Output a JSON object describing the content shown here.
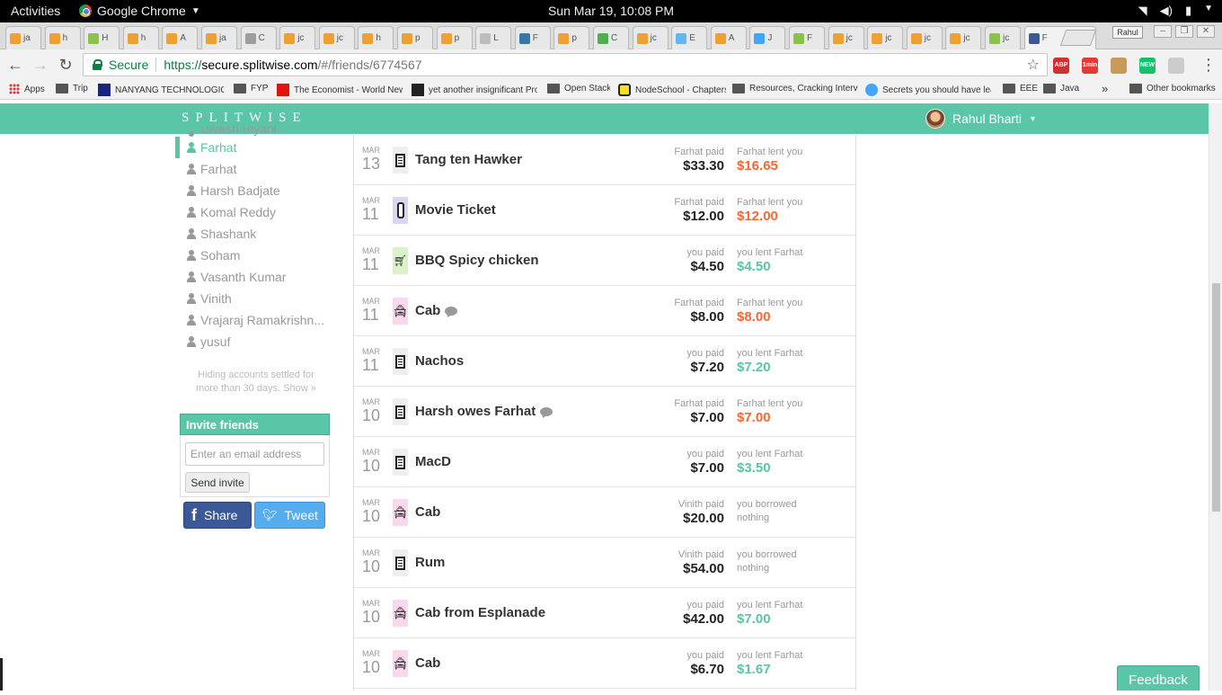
{
  "gnome": {
    "activities": "Activities",
    "app_name": "Google Chrome",
    "clock": "Sun Mar 19, 10:08 PM"
  },
  "browser": {
    "tabs": [
      {
        "label": "ja",
        "color": "#f0a030"
      },
      {
        "label": "h",
        "color": "#f0a030"
      },
      {
        "label": "H",
        "color": "#8bc34a"
      },
      {
        "label": "h",
        "color": "#f0a030"
      },
      {
        "label": "A",
        "color": "#f0a030"
      },
      {
        "label": "ja",
        "color": "#f0a030"
      },
      {
        "label": "C",
        "color": "#9e9e9e"
      },
      {
        "label": "jc",
        "color": "#f0a030"
      },
      {
        "label": "jc",
        "color": "#f0a030"
      },
      {
        "label": "h",
        "color": "#f0a030"
      },
      {
        "label": "p",
        "color": "#f0a030"
      },
      {
        "label": "p",
        "color": "#f0a030"
      },
      {
        "label": "L",
        "color": "#bdbdbd"
      },
      {
        "label": "F",
        "color": "#3776ab"
      },
      {
        "label": "p",
        "color": "#f0a030"
      },
      {
        "label": "C",
        "color": "#4caf50"
      },
      {
        "label": "jc",
        "color": "#f0a030"
      },
      {
        "label": "E",
        "color": "#64b5f6"
      },
      {
        "label": "A",
        "color": "#f0a030"
      },
      {
        "label": "J",
        "color": "#42a5f5"
      },
      {
        "label": "F",
        "color": "#8bc34a"
      },
      {
        "label": "jc",
        "color": "#f0a030"
      },
      {
        "label": "jc",
        "color": "#f0a030"
      },
      {
        "label": "jc",
        "color": "#f0a030"
      },
      {
        "label": "jc",
        "color": "#f0a030"
      },
      {
        "label": "jc",
        "color": "#8bc34a"
      },
      {
        "label": "F",
        "color": "#3b5998"
      }
    ],
    "active_tab_label": "F",
    "profile": "Rahul",
    "omnibox": {
      "secure_label": "Secure",
      "url_scheme": "https://",
      "url_host": "secure.splitwise.com",
      "url_path": "/#/friends/6774567"
    },
    "extensions": [
      {
        "label": "ABP",
        "color": "#d32f2f"
      },
      {
        "label": "1min",
        "color": "#e53935"
      },
      {
        "label": "",
        "color": "#c89a5a"
      },
      {
        "label": "NEW",
        "color": "#15c26b"
      },
      {
        "label": "",
        "color": "#cccccc"
      }
    ],
    "bookmarks": [
      {
        "label": "Apps",
        "icon": "apps-icon"
      },
      {
        "label": "Trip",
        "icon": "folder-icon"
      },
      {
        "label": "NANYANG TECHNOLOGICAL",
        "icon": "ntu-icon"
      },
      {
        "label": "FYP",
        "icon": "folder-icon"
      },
      {
        "label": "The Economist - World News",
        "icon": "economist-icon"
      },
      {
        "label": "yet another insignificant Prog",
        "icon": "blog-icon"
      },
      {
        "label": "Open Stack",
        "icon": "folder-icon"
      },
      {
        "label": "NodeSchool - Chapters",
        "icon": "nodeschool-icon"
      },
      {
        "label": "Resources, Cracking Intervie",
        "icon": "folder-icon"
      },
      {
        "label": "Secrets you should have lear",
        "icon": "secrets-icon"
      },
      {
        "label": "EEE",
        "icon": "folder-icon"
      },
      {
        "label": "Java",
        "icon": "folder-icon"
      }
    ],
    "bookmarks_overflow": "»",
    "other_bookmarks": "Other bookmarks"
  },
  "header": {
    "logo": "SPLITWISE",
    "user_name": "Rahul Bharti"
  },
  "sidebar": {
    "friends": [
      {
        "name": "Divesh Biyani",
        "active": false,
        "clipped": true
      },
      {
        "name": "Farhat",
        "active": true,
        "clipped": false
      },
      {
        "name": "Farhat",
        "active": false,
        "clipped": false
      },
      {
        "name": "Harsh Badjate",
        "active": false,
        "clipped": false
      },
      {
        "name": "Komal Reddy",
        "active": false,
        "clipped": false
      },
      {
        "name": "Shashank",
        "active": false,
        "clipped": false
      },
      {
        "name": "Soham",
        "active": false,
        "clipped": false
      },
      {
        "name": "Vasanth Kumar",
        "active": false,
        "clipped": false
      },
      {
        "name": "Vinith",
        "active": false,
        "clipped": false
      },
      {
        "name": "Vrajaraj Ramakrishn...",
        "active": false,
        "clipped": false
      },
      {
        "name": "yusuf",
        "active": false,
        "clipped": false
      }
    ],
    "hidden_note": "Hiding accounts settled for more than 30 days. Show »",
    "invite": {
      "title": "Invite friends",
      "placeholder": "Enter an email address",
      "button": "Send invite"
    },
    "share_label": "Share",
    "tweet_label": "Tweet"
  },
  "expenses": [
    {
      "month": "MAR",
      "day": "13",
      "category": "receipt",
      "description": "Tang ten Hawker",
      "comment": false,
      "paid_label": "Farhat paid",
      "paid_amount": "$33.30",
      "lent_label": "Farhat lent you",
      "lent_amount": "$16.65",
      "lent_kind": "neg"
    },
    {
      "month": "MAR",
      "day": "11",
      "category": "movie",
      "description": "Movie Ticket",
      "comment": false,
      "paid_label": "Farhat paid",
      "paid_amount": "$12.00",
      "lent_label": "Farhat lent you",
      "lent_amount": "$12.00",
      "lent_kind": "neg"
    },
    {
      "month": "MAR",
      "day": "11",
      "category": "grocery",
      "description": "BBQ Spicy chicken",
      "comment": false,
      "paid_label": "you paid",
      "paid_amount": "$4.50",
      "lent_label": "you lent Farhat",
      "lent_amount": "$4.50",
      "lent_kind": "pos"
    },
    {
      "month": "MAR",
      "day": "11",
      "category": "taxi",
      "description": "Cab",
      "comment": true,
      "paid_label": "Farhat paid",
      "paid_amount": "$8.00",
      "lent_label": "Farhat lent you",
      "lent_amount": "$8.00",
      "lent_kind": "neg"
    },
    {
      "month": "MAR",
      "day": "11",
      "category": "receipt",
      "description": "Nachos",
      "comment": false,
      "paid_label": "you paid",
      "paid_amount": "$7.20",
      "lent_label": "you lent Farhat",
      "lent_amount": "$7.20",
      "lent_kind": "pos"
    },
    {
      "month": "MAR",
      "day": "10",
      "category": "receipt",
      "description": "Harsh owes Farhat",
      "comment": true,
      "paid_label": "Farhat paid",
      "paid_amount": "$7.00",
      "lent_label": "Farhat lent you",
      "lent_amount": "$7.00",
      "lent_kind": "neg"
    },
    {
      "month": "MAR",
      "day": "10",
      "category": "receipt",
      "description": "MacD",
      "comment": false,
      "paid_label": "you paid",
      "paid_amount": "$7.00",
      "lent_label": "you lent Farhat",
      "lent_amount": "$3.50",
      "lent_kind": "pos"
    },
    {
      "month": "MAR",
      "day": "10",
      "category": "taxi",
      "description": "Cab",
      "comment": false,
      "paid_label": "Vinith paid",
      "paid_amount": "$20.00",
      "lent_label": "you borrowed",
      "lent_amount": "nothing",
      "lent_kind": "none"
    },
    {
      "month": "MAR",
      "day": "10",
      "category": "receipt",
      "description": "Rum",
      "comment": false,
      "paid_label": "Vinith paid",
      "paid_amount": "$54.00",
      "lent_label": "you borrowed",
      "lent_amount": "nothing",
      "lent_kind": "none"
    },
    {
      "month": "MAR",
      "day": "10",
      "category": "taxi",
      "description": "Cab from Esplanade",
      "comment": false,
      "paid_label": "you paid",
      "paid_amount": "$42.00",
      "lent_label": "you lent Farhat",
      "lent_amount": "$7.00",
      "lent_kind": "pos"
    },
    {
      "month": "MAR",
      "day": "10",
      "category": "taxi",
      "description": "Cab",
      "comment": false,
      "paid_label": "you paid",
      "paid_amount": "$6.70",
      "lent_label": "you lent Farhat",
      "lent_amount": "$1.67",
      "lent_kind": "pos"
    }
  ],
  "feedback_label": "Feedback",
  "colors": {
    "brand": "#5bc5a7",
    "owed": "#ff652f",
    "lent": "#5bc5a7"
  }
}
